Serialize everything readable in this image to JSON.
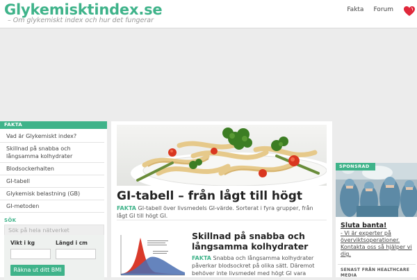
{
  "header": {
    "logo": "Glykemisktindex.se",
    "tagline": "– Om glykemiskt index och hur det fungerar",
    "nav": [
      "Fakta",
      "Forum"
    ]
  },
  "colors": {
    "brand": "#3fb38a",
    "heart": "#e0283b"
  },
  "icons": {
    "favorite": "heart-icon"
  },
  "sidebar": {
    "heading": "FAKTA",
    "items": [
      "Vad är Glykemiskt index?",
      "Skillnad på snabba och långsamma kolhydrater",
      "Blodsockerhalten",
      "GI-tabell",
      "Glykemisk belastning (GB)",
      "GI-metoden"
    ],
    "search": {
      "label": "SÖK",
      "placeholder": "Sök på hela nätverket"
    },
    "bmi": {
      "weight_label": "Vikt i kg",
      "height_label": "Längd i cm",
      "button": "Räkna ut ditt BMI"
    }
  },
  "main": {
    "article1": {
      "title": "GI-tabell – från lågt till högt",
      "tag": "FAKTA",
      "excerpt": "GI-tabell över livsmedels GI-värde. Sorterat i fyra grupper, från lågt GI till högt GI."
    },
    "article2": {
      "title": "Skillnad på snabba och långsamma kolhydrater",
      "tag": "FAKTA",
      "excerpt": "Snabba och långsamma kolhydrater påverkar blodsockret på olika sätt. Däremot behöver inte livsmedel med högt GI vara"
    }
  },
  "right_sidebar": {
    "tag": "SPONSRAD",
    "title": "Sluta banta!",
    "text": "- Vi är experter på överviktsoperationer. Kontakta oss så hjälper vi dig.",
    "news_heading": "SENAST FRÅN HEALTHCARE MEDIA"
  }
}
